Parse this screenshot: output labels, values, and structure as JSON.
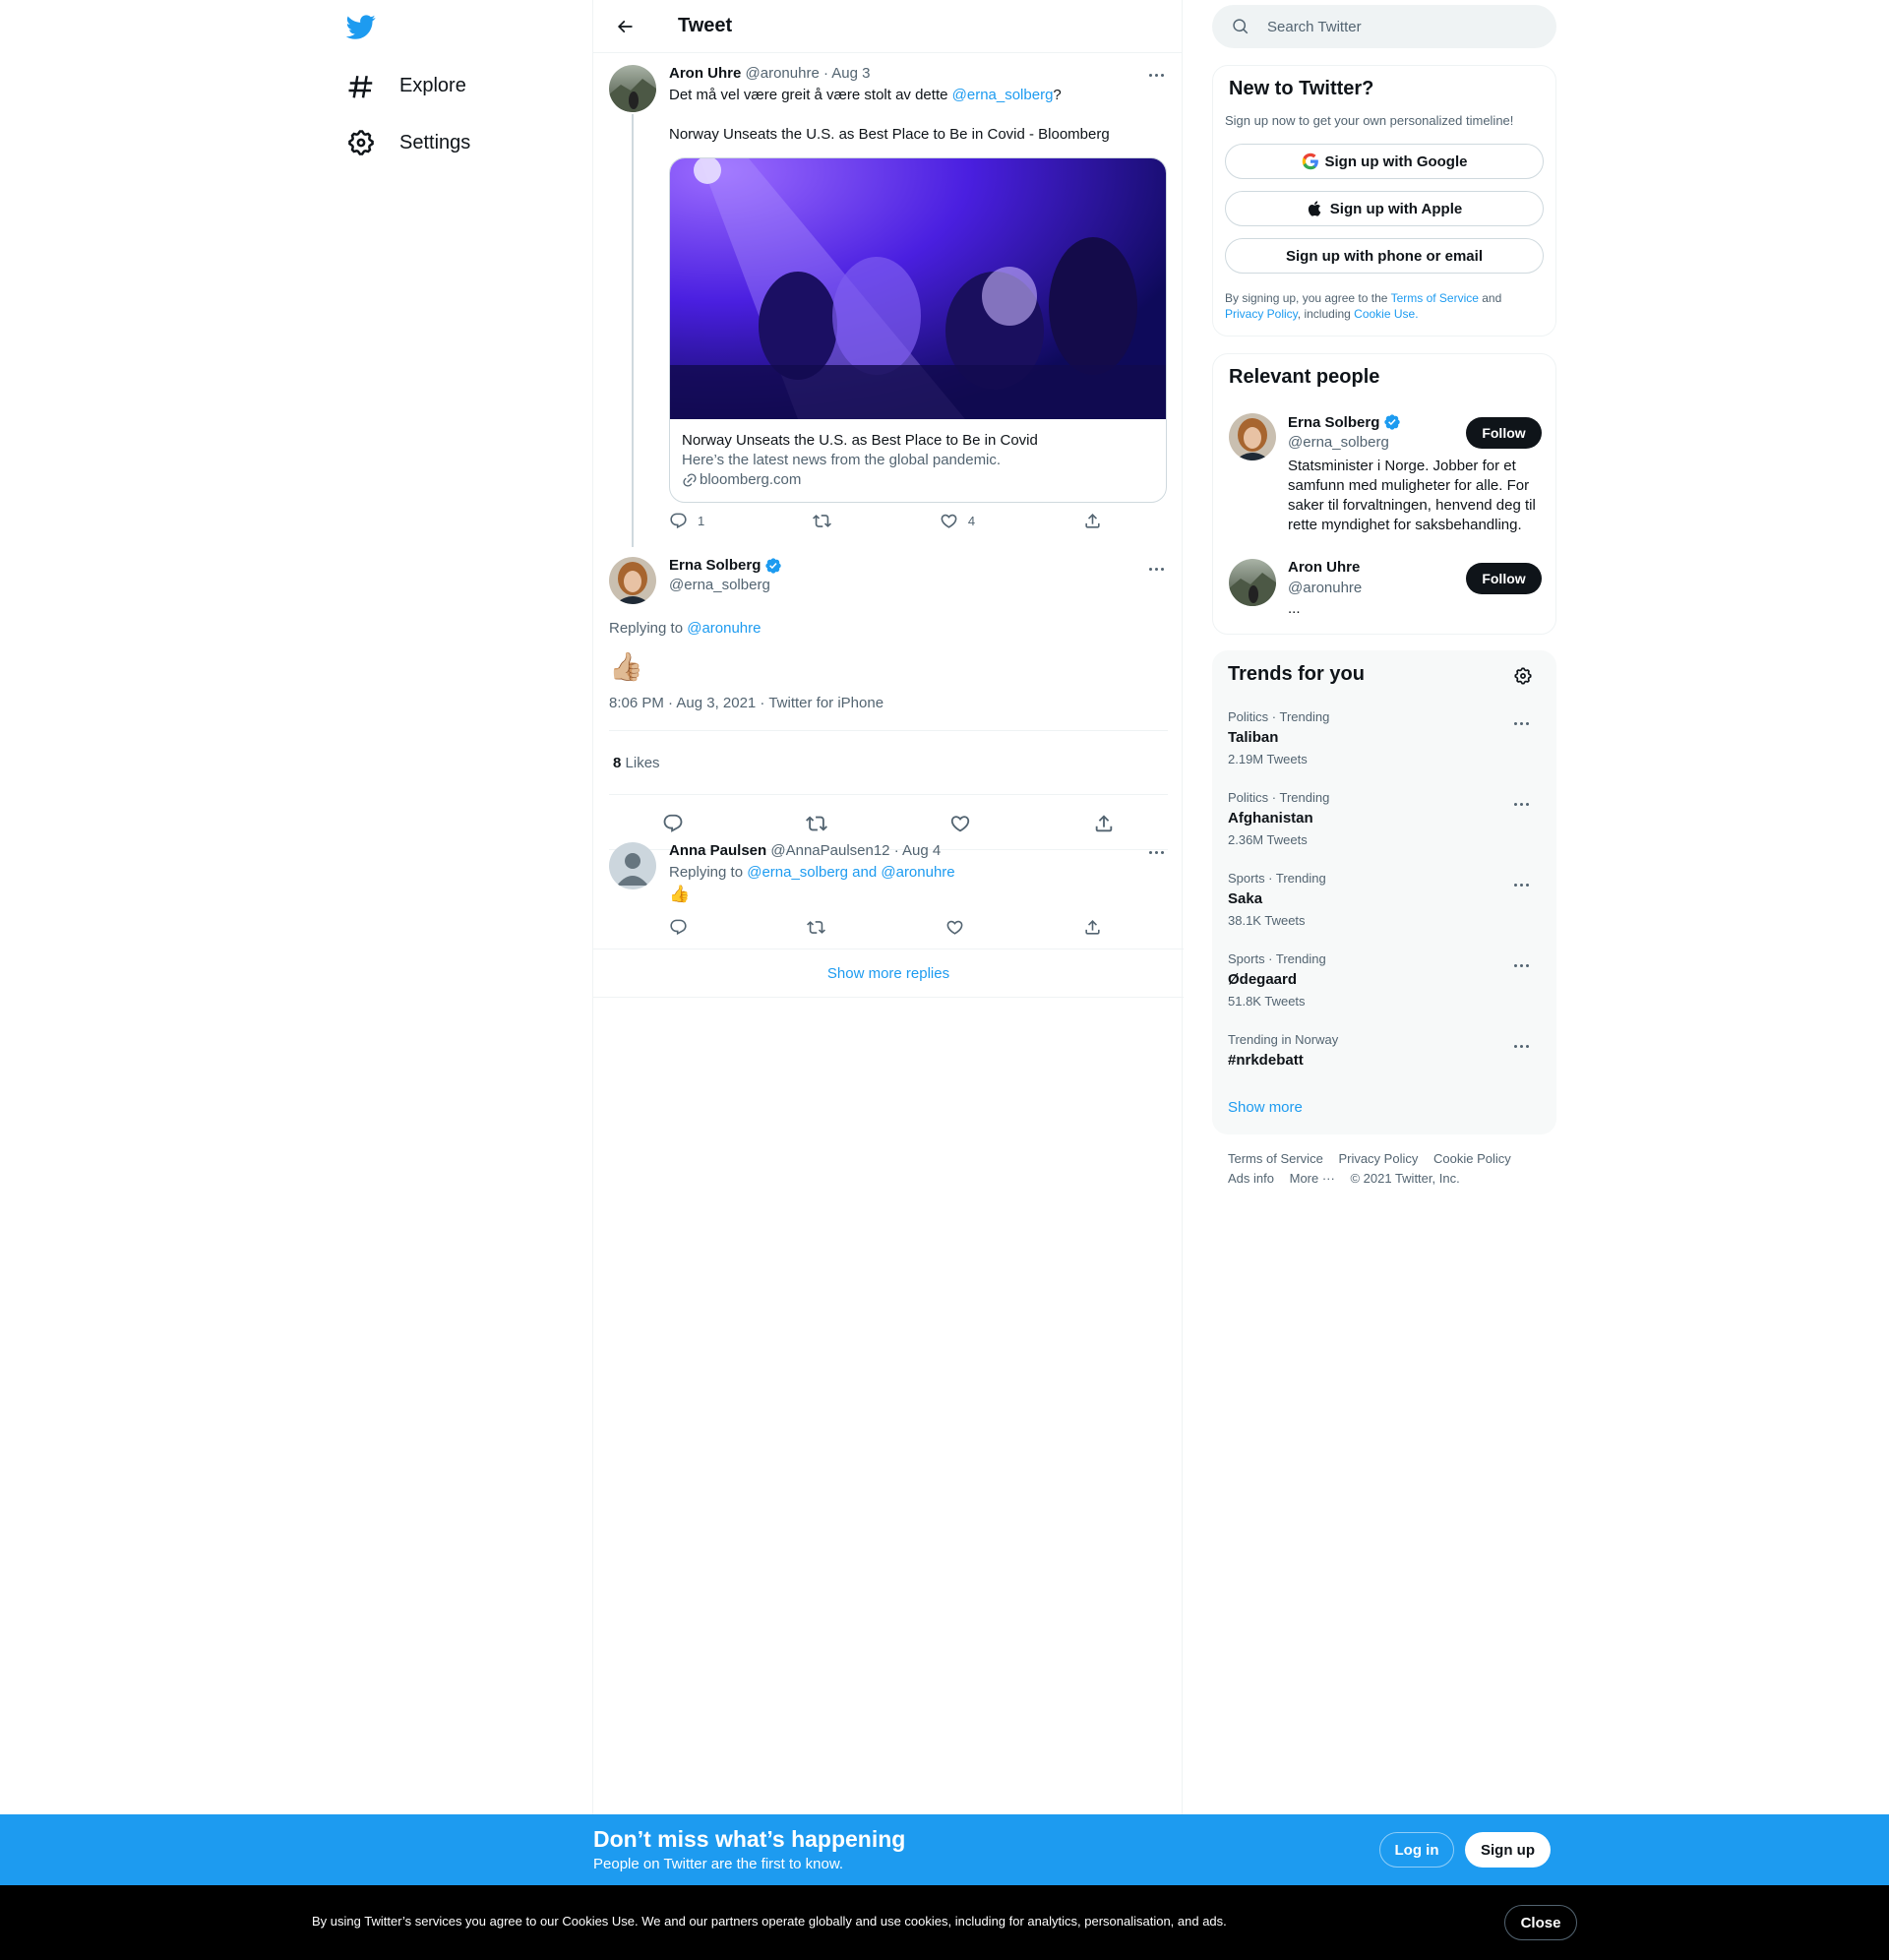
{
  "nav": {
    "explore_label": "Explore",
    "settings_label": "Settings"
  },
  "header": {
    "title": "Tweet"
  },
  "parent_tweet": {
    "author_name": "Aron Uhre",
    "author_handle": "@aronuhre",
    "date": "· Aug 3",
    "text_before": "Det må vel være greit å være stolt av dette ",
    "mention": "@erna_solberg",
    "text_after": "?",
    "text_line2": "Norway Unseats the U.S. as Best Place to Be in Covid - Bloomberg",
    "card": {
      "title": "Norway Unseats the U.S. as Best Place to Be in Covid",
      "description": "Here’s the latest news from the global pandemic.",
      "domain": "bloomberg.com"
    },
    "reply_count": "1",
    "like_count": "4"
  },
  "focal_tweet": {
    "author_name": "Erna Solberg",
    "author_handle": "@erna_solberg",
    "replying_to_label": "Replying to ",
    "replying_to_handle": "@aronuhre",
    "emoji": "👍🏼",
    "timestamp": "8:06 PM · Aug 3, 2021 · Twitter for iPhone",
    "likes_count": "8",
    "likes_label": "Likes"
  },
  "reply_tweet": {
    "author_name": "Anna Paulsen",
    "author_handle": "@AnnaPaulsen12",
    "date": "· Aug 4",
    "replying_to_label": "Replying to ",
    "replying_to_handles": "@erna_solberg and @aronuhre",
    "emoji": "👍"
  },
  "show_more_replies": "Show more replies",
  "search": {
    "placeholder": "Search Twitter"
  },
  "new_to_twitter": {
    "title": "New to Twitter?",
    "subtitle": "Sign up now to get your own personalized timeline!",
    "google_label": "Sign up with Google",
    "apple_label": "Sign up with Apple",
    "email_label": "Sign up with phone or email",
    "legal_prefix": "By signing up, you agree to the ",
    "terms": "Terms of Service",
    "and": " and",
    "privacy": "Privacy Policy",
    "including": ", including ",
    "cookie": "Cookie Use."
  },
  "relevant_people": {
    "title": "Relevant people",
    "people": [
      {
        "name": "Erna Solberg",
        "handle": "@erna_solberg",
        "bio": "Statsminister i Norge. Jobber for et samfunn med muligheter for alle. For saker til forvaltningen, henvend deg til rette myndighet for saksbehandling.",
        "follow_label": "Follow"
      },
      {
        "name": "Aron Uhre",
        "handle": "@aronuhre",
        "bio": "...",
        "follow_label": "Follow"
      }
    ]
  },
  "trends": {
    "title": "Trends for you",
    "items": [
      {
        "context": "Politics · Trending",
        "name": "Taliban",
        "count": "2.19M Tweets"
      },
      {
        "context": "Politics · Trending",
        "name": "Afghanistan",
        "count": "2.36M Tweets"
      },
      {
        "context": "Sports · Trending",
        "name": "Saka",
        "count": "38.1K Tweets"
      },
      {
        "context": "Sports · Trending",
        "name": "Ødegaard",
        "count": "51.8K Tweets"
      },
      {
        "context": "Trending in Norway",
        "name": "#nrkdebatt",
        "count": ""
      }
    ],
    "show_more": "Show more"
  },
  "footer": {
    "terms": "Terms of Service",
    "privacy": "Privacy Policy",
    "cookie": "Cookie Policy",
    "ads": "Ads info",
    "more": "More ···",
    "copyright": "© 2021 Twitter, Inc."
  },
  "bottom_bar": {
    "title": "Don’t miss what’s happening",
    "subtitle": "People on Twitter are the first to know.",
    "login_label": "Log in",
    "signup_label": "Sign up"
  },
  "cookie_bar": {
    "text": "By using Twitter’s services you agree to our Cookies Use. We and our partners operate globally and use cookies, including for analytics, personalisation, and ads.",
    "close_label": "Close"
  },
  "colors": {
    "accent": "#1d9bf0",
    "text": "#0f1419",
    "secondary": "#536471",
    "border": "#eff3f4"
  }
}
